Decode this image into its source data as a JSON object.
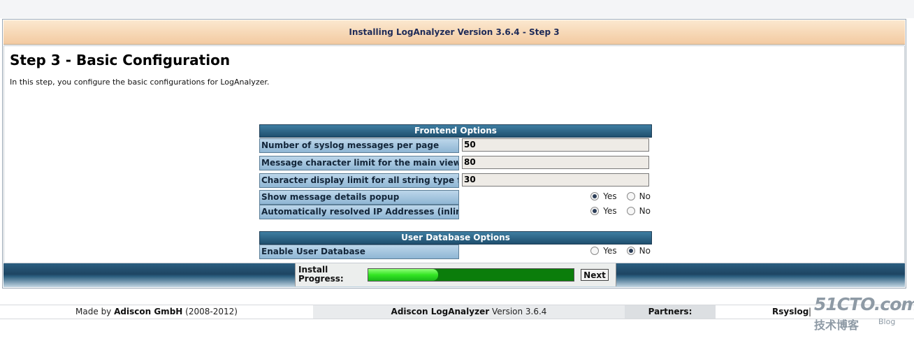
{
  "header": {
    "title": "Installing LogAnalyzer Version 3.6.4 - Step 3"
  },
  "step": {
    "title": "Step 3 - Basic Configuration",
    "intro": "In this step, you configure the basic configurations for LogAnalyzer."
  },
  "frontend": {
    "heading": "Frontend Options",
    "rows": [
      {
        "label": "Number of syslog messages per page",
        "value": "50"
      },
      {
        "label": "Message character limit for the main view",
        "value": "80"
      },
      {
        "label": "Character display limit for all string type fields",
        "value": "30"
      }
    ],
    "radio_rows": [
      {
        "label": "Show message details popup",
        "yes": "Yes",
        "no": "No",
        "selected": "yes"
      },
      {
        "label": "Automatically resolved IP Addresses (inline)",
        "yes": "Yes",
        "no": "No",
        "selected": "yes"
      }
    ]
  },
  "userdb": {
    "heading": "User Database Options",
    "row": {
      "label": "Enable User Database",
      "yes": "Yes",
      "no": "No",
      "selected": "no"
    }
  },
  "install": {
    "label_line1": "Install",
    "label_line2": "Progress:",
    "progress_fraction": 0.34,
    "next_label": "Next"
  },
  "footer": {
    "made_by_prefix": "Made by",
    "company": "Adiscon GmbH",
    "years": "(2008-2012)",
    "product": "Adiscon LogAnalyzer",
    "version": "Version 3.6.4",
    "partners_label": "Partners:",
    "partner": "Rsyslog",
    "separator": "|"
  },
  "watermark": {
    "line1": "51CTO.com",
    "line2": "技术博客",
    "line3": "Blog"
  }
}
